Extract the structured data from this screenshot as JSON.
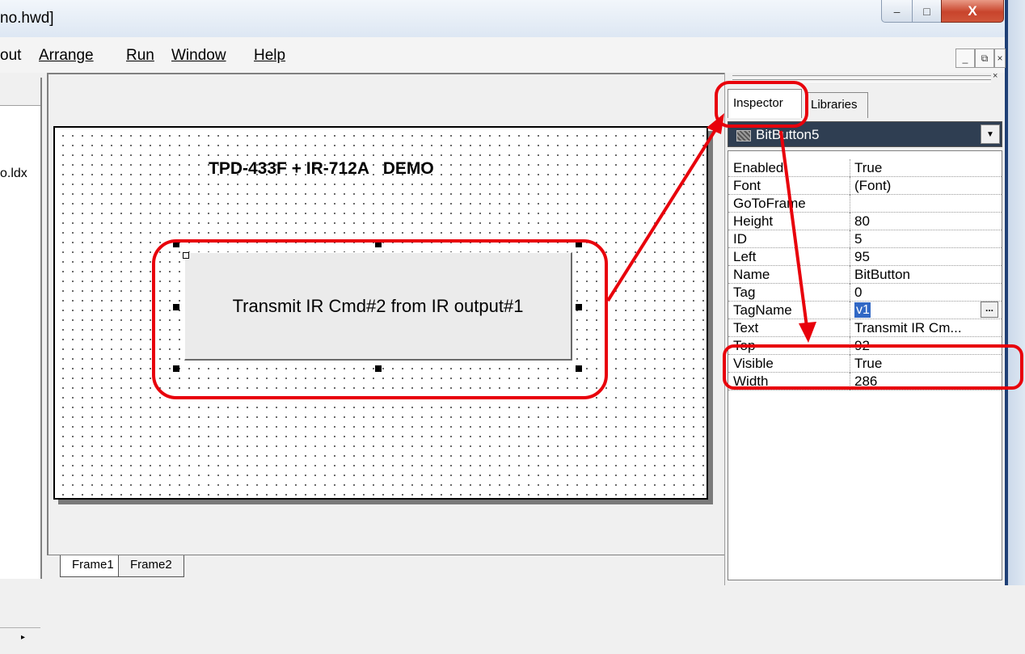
{
  "window": {
    "title": "no.hwd]",
    "controls": {
      "minimize": "–",
      "maximize": "□",
      "close": "X"
    }
  },
  "menu": {
    "items": [
      {
        "label": "out",
        "underline_index": -1
      },
      {
        "label": "Arrange",
        "underline_index": 0
      },
      {
        "label": "Run",
        "underline_index": 0
      },
      {
        "label": "Window",
        "underline_index": 0
      },
      {
        "label": "Help",
        "underline_index": 0
      }
    ],
    "mdi_controls": {
      "minimize": "_",
      "restore": "⧉",
      "close": "×"
    }
  },
  "left_panel": {
    "file_label": "o.ldx"
  },
  "canvas": {
    "title": "TPD-433F + IR-712A   DEMO",
    "button_text": "Transmit IR Cmd#2 from IR output#1"
  },
  "frame_tabs": [
    "Frame1",
    "Frame2"
  ],
  "inspector": {
    "tabs": {
      "inspector": "Inspector",
      "libraries": "Libraries"
    },
    "selected_object": "BitButton5",
    "properties": [
      {
        "name": "Enabled",
        "value": "True"
      },
      {
        "name": "Font",
        "value": "(Font)"
      },
      {
        "name": "GoToFrame",
        "value": ""
      },
      {
        "name": "Height",
        "value": "80"
      },
      {
        "name": "ID",
        "value": "5"
      },
      {
        "name": "Left",
        "value": "95"
      },
      {
        "name": "Name",
        "value": "BitButton"
      },
      {
        "name": "Tag",
        "value": "0"
      },
      {
        "name": "TagName",
        "value": "v1"
      },
      {
        "name": "Text",
        "value": "Transmit IR Cm..."
      },
      {
        "name": "Top",
        "value": "92"
      },
      {
        "name": "Visible",
        "value": "True"
      },
      {
        "name": "Width",
        "value": "286"
      }
    ],
    "ellipsis": "..."
  },
  "colors": {
    "annotation": "#e8000b",
    "selection": "#3168c5"
  }
}
